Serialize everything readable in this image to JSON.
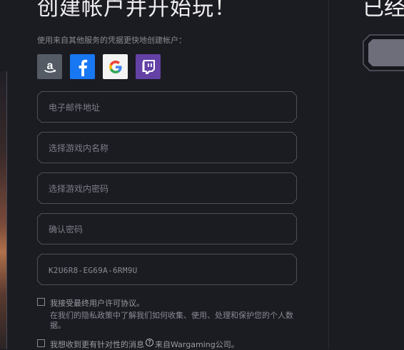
{
  "header": {
    "title": "创建帐户并开始玩！"
  },
  "signup": {
    "subtitle": "使用来自其他服务的凭据更快地创建帐户：",
    "social": [
      {
        "name": "amazon",
        "icon": "amazon-icon",
        "color": "#545b64"
      },
      {
        "name": "facebook",
        "icon": "facebook-icon",
        "color": "#1877f2"
      },
      {
        "name": "google",
        "icon": "google-icon",
        "color": "#f4f4f4"
      },
      {
        "name": "twitch",
        "icon": "twitch-icon",
        "color": "#6441a5"
      }
    ],
    "fields": {
      "email_placeholder": "电子邮件地址",
      "nickname_placeholder": "选择游戏内名称",
      "password_placeholder": "选择游戏内密码",
      "confirm_placeholder": "确认密码",
      "invite_code_value": "K2U6R8-EG69A-6RM9U"
    },
    "eula_label": "我接受最终用户许可协议。",
    "privacy_note": "在我们的隐私政策中了解我们如何收集、使用、处理和保护您的个人数据。",
    "marketing_label_before": "我想收到更有针对性的消息",
    "marketing_label_after": "来自Wargaming公司。"
  },
  "login_panel": {
    "title": "已经"
  }
}
